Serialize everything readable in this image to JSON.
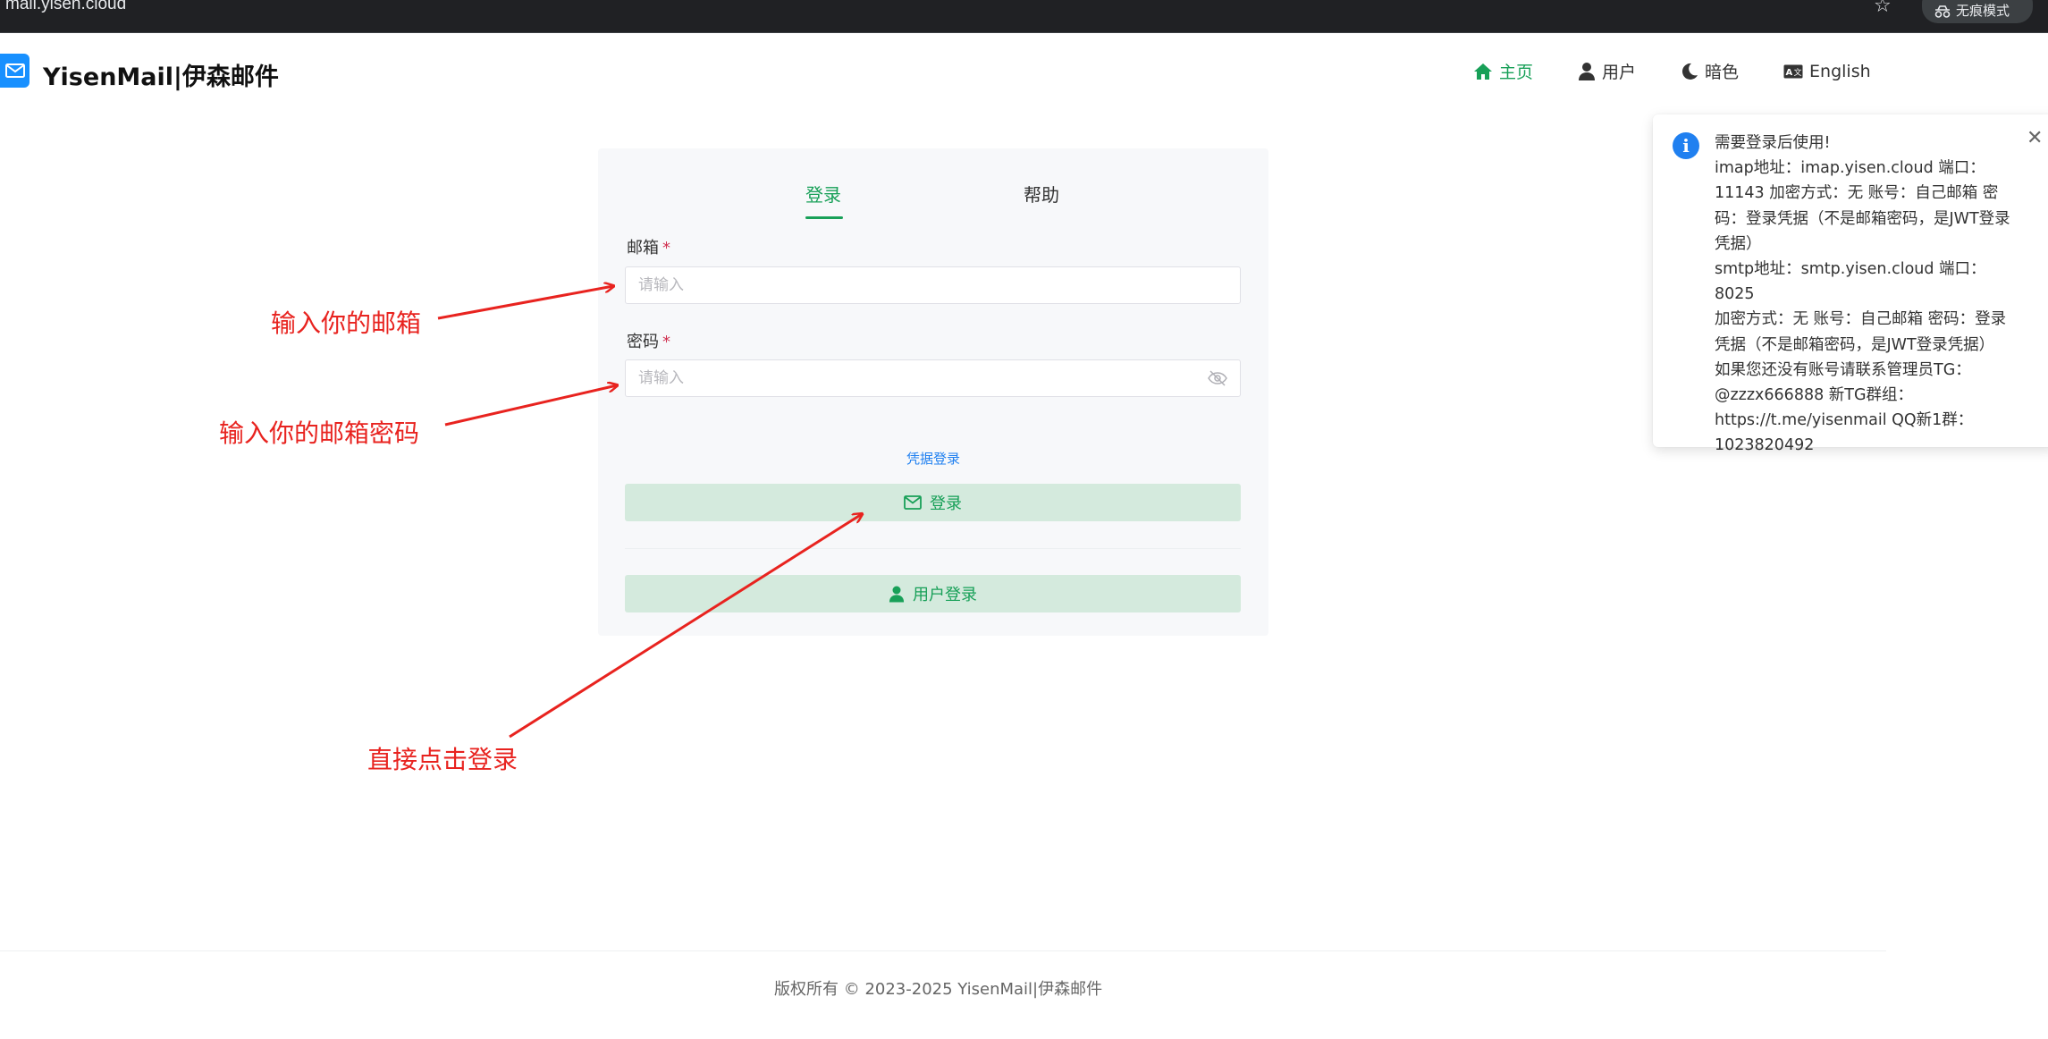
{
  "browser": {
    "url": "mail.yisen.cloud",
    "incognito_label": "无痕模式"
  },
  "header": {
    "brand": "YisenMail|伊森邮件",
    "nav": [
      {
        "label": "主页",
        "icon": "home-icon"
      },
      {
        "label": "用户",
        "icon": "user-icon"
      },
      {
        "label": "暗色",
        "icon": "moon-icon"
      },
      {
        "label": "English",
        "icon": "translate-icon"
      }
    ]
  },
  "notification": {
    "lines": [
      "需要登录后使用!",
      "imap地址：imap.yisen.cloud 端口：",
      "11143 加密方式：无  账号：自己邮箱 密",
      "码：登录凭据（不是邮箱密码，是JWT登录",
      "凭据）",
      "smtp地址：smtp.yisen.cloud 端口：8025",
      "加密方式：无  账号：自己邮箱 密码：登录",
      "凭据（不是邮箱密码，是JWT登录凭据）",
      "如果您还没有账号请联系管理员TG：",
      "@zzzx666888      新TG群组：",
      "https://t.me/yisenmail  QQ新1群：",
      "1023820492"
    ]
  },
  "login": {
    "tabs": [
      "登录",
      "帮助"
    ],
    "email_label": "邮箱",
    "password_label": "密码",
    "required_mark": "*",
    "email_placeholder": "请输入",
    "password_placeholder": "请输入",
    "credential_link": "凭据登录",
    "login_button": "登录",
    "user_login_button": "用户登录"
  },
  "annotations": {
    "email": "输入你的邮箱",
    "password": "输入你的邮箱密码",
    "click": "直接点击登录"
  },
  "footer": {
    "text": "版权所有 © 2023-2025   YisenMail|伊森邮件"
  },
  "colors": {
    "accent": "#18a058",
    "button_bg": "#d4eadd",
    "info": "#2080f0",
    "annotation": "#e8231f"
  }
}
